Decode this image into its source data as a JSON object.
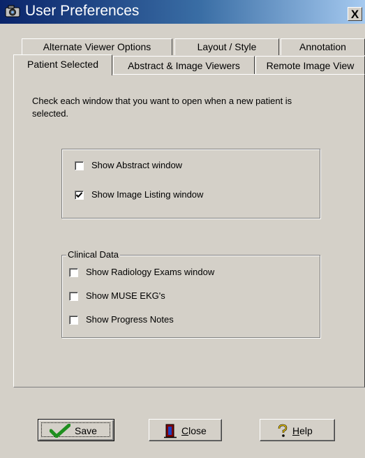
{
  "window": {
    "title": "User Preferences",
    "close_label": "X"
  },
  "tabs": {
    "row1": [
      "Alternate Viewer Options",
      "Layout / Style",
      "Annotation"
    ],
    "row2": [
      "Patient Selected",
      "Abstract & Image Viewers",
      "Remote Image View"
    ],
    "active": "Patient Selected"
  },
  "panel": {
    "instruction": "Check each window that you want to open when a new patient is selected.",
    "windows": [
      {
        "label": "Show Abstract window",
        "checked": false
      },
      {
        "label": "Show Image Listing window",
        "checked": true
      }
    ],
    "clinical_group_title": "Clinical Data",
    "clinical": [
      {
        "label": "Show Radiology Exams window",
        "checked": false
      },
      {
        "label": "Show MUSE EKG's",
        "checked": false
      },
      {
        "label": "Show Progress Notes",
        "checked": false
      }
    ]
  },
  "buttons": {
    "save": {
      "label": "Save",
      "icon": "checkmark-icon"
    },
    "close": {
      "label": "Close",
      "icon": "door-icon"
    },
    "help": {
      "label": "Help",
      "icon": "question-icon"
    }
  }
}
